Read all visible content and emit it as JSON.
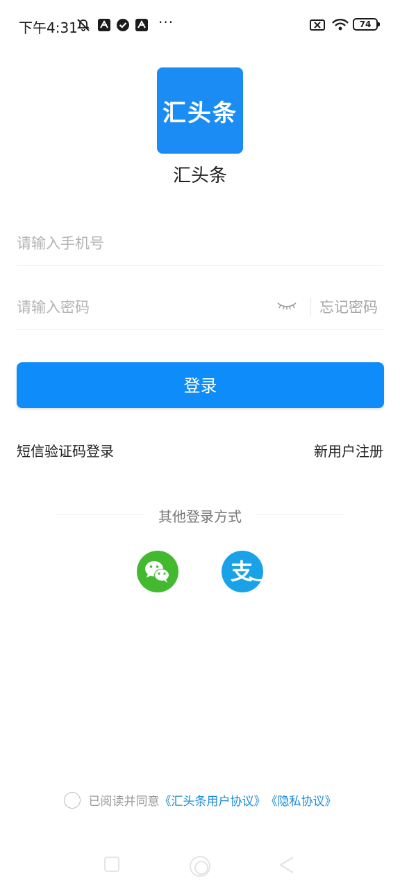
{
  "status_bar": {
    "time": "下午4:31",
    "more": "···",
    "battery": "74"
  },
  "app": {
    "logo_text": "汇头条",
    "name": "汇头条"
  },
  "form": {
    "phone_placeholder": "请输入手机号",
    "password_placeholder": "请输入密码",
    "forgot_label": "忘记密码",
    "login_label": "登录",
    "sms_login_label": "短信验证码登录",
    "register_label": "新用户注册"
  },
  "other_login": {
    "title": "其他登录方式",
    "alipay_glyph": "支",
    "providers": [
      "wechat",
      "alipay"
    ]
  },
  "agreement": {
    "prefix": "已阅读并同意",
    "user_agreement": "《汇头条用户协议》",
    "privacy_policy": "《隐私协议》"
  },
  "colors": {
    "primary": "#0d8cfa",
    "logo_bg": "#1a8cf3",
    "wechat": "#43b930",
    "alipay": "#1aa2e8",
    "link": "#1a8cd8"
  }
}
